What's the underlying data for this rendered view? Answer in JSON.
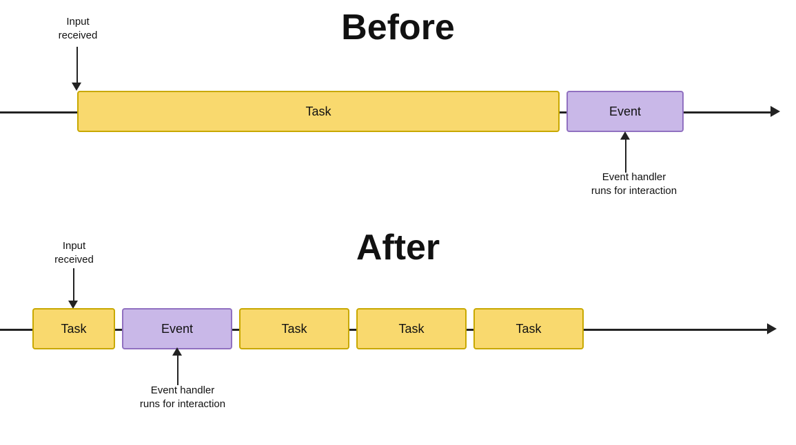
{
  "before": {
    "title": "Before",
    "input_received_label": "Input\nreceived",
    "event_handler_label": "Event handler\nruns for interaction",
    "task_label": "Task",
    "event_label": "Event"
  },
  "after": {
    "title": "After",
    "input_received_label": "Input\nreceived",
    "event_handler_label": "Event handler\nruns for interaction",
    "task_label": "Task",
    "event_label": "Event"
  },
  "colors": {
    "task_bg": "#f9d96e",
    "task_border": "#c8a800",
    "event_bg": "#c9b8e8",
    "event_border": "#9070c0",
    "line": "#222222",
    "text": "#111111"
  }
}
